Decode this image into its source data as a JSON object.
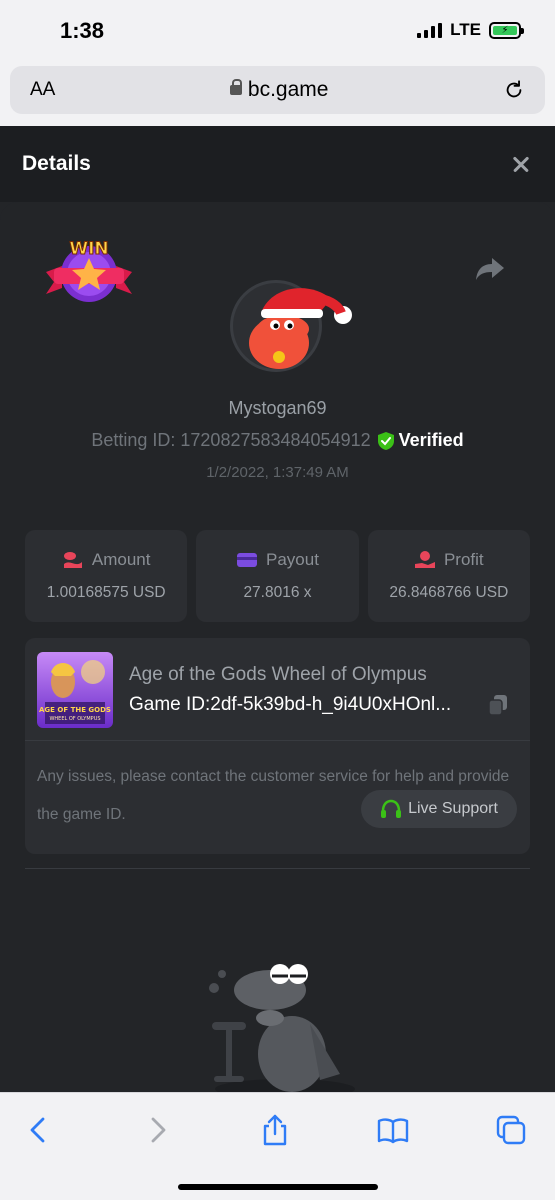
{
  "status_bar": {
    "time": "1:38",
    "network": "LTE"
  },
  "browser": {
    "aa_label": "AA",
    "url": "bc.game"
  },
  "header": {
    "title": "Details"
  },
  "bet": {
    "badge_text": "WIN",
    "username": "Mystogan69",
    "betting_id_label": "Betting ID: 1720827583484054912",
    "verified_label": "Verified",
    "timestamp": "1/2/2022, 1:37:49 AM"
  },
  "stats": [
    {
      "label": "Amount",
      "value": "1.00168575 USD",
      "icon": "coins-icon",
      "color": "#e8455a"
    },
    {
      "label": "Payout",
      "value": "27.8016 x",
      "icon": "card-icon",
      "color": "#7b4ce0"
    },
    {
      "label": "Profit",
      "value": "26.8468766 USD",
      "icon": "hand-coin-icon",
      "color": "#e8455a"
    }
  ],
  "game": {
    "name": "Age of the Gods Wheel of Olympus",
    "id": "Game ID:2df-5k39bd-h_9i4U0xHOnl...",
    "thumb_title": "AGE OF THE GODS",
    "thumb_subtitle": "WHEEL OF OLYMPUS",
    "help_text": "Any issues, please contact the customer service for help and provide the game ID.",
    "live_support_label": "Live Support"
  },
  "colors": {
    "verified": "#3bc117",
    "live_support_icon": "#3bc117",
    "ios_blue": "#2f7cf6"
  }
}
